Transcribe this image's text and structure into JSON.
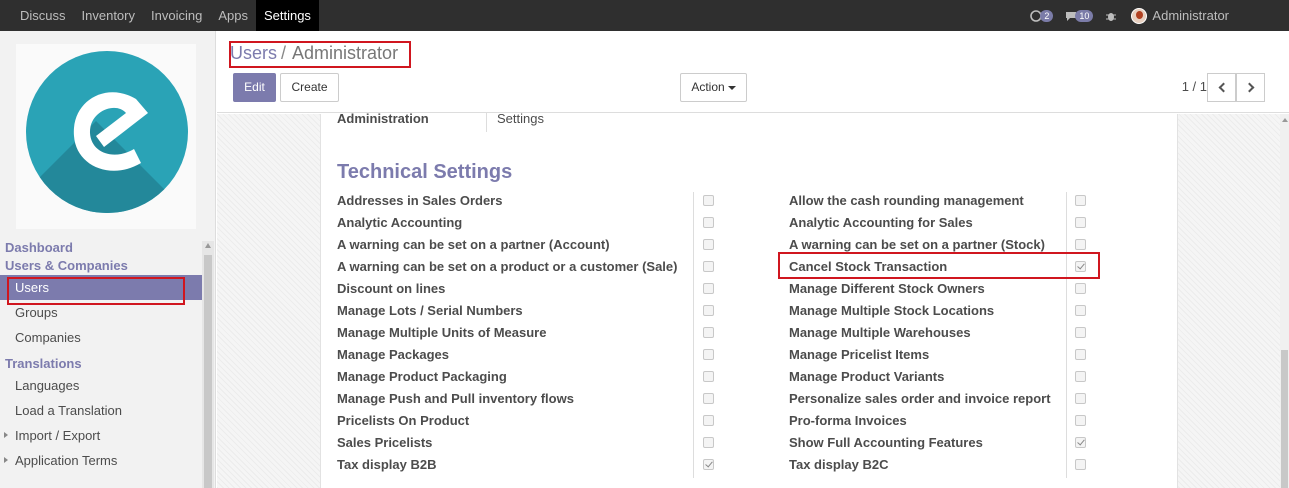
{
  "topbar": {
    "menu": [
      "Discuss",
      "Inventory",
      "Invoicing",
      "Apps",
      "Settings"
    ],
    "active_index": 4,
    "chat_count": "2",
    "messages_count": "10",
    "user": "Administrator"
  },
  "sidebar": {
    "sections": [
      {
        "header": "Dashboard",
        "items": []
      },
      {
        "header": "Users & Companies",
        "items": [
          "Users",
          "Groups",
          "Companies"
        ]
      },
      {
        "header": "Translations",
        "items": [
          "Languages",
          "Load a Translation",
          "Import / Export",
          "Application Terms"
        ]
      }
    ],
    "active_item": "Users"
  },
  "control_panel": {
    "breadcrumb_parent": "Users",
    "breadcrumb_sep": "/",
    "breadcrumb_current": "Administrator",
    "edit_label": "Edit",
    "create_label": "Create",
    "action_label": "Action",
    "pager": "1 / 1"
  },
  "form": {
    "admin_label": "Administration",
    "admin_value": "Settings",
    "section_title": "Technical Settings",
    "left": [
      {
        "label": "Addresses in Sales Orders",
        "checked": false
      },
      {
        "label": "Analytic Accounting",
        "checked": false
      },
      {
        "label": "A warning can be set on a partner (Account)",
        "checked": false
      },
      {
        "label": "A warning can be set on a product or a customer (Sale)",
        "checked": false
      },
      {
        "label": "Discount on lines",
        "checked": false
      },
      {
        "label": "Manage Lots / Serial Numbers",
        "checked": false
      },
      {
        "label": "Manage Multiple Units of Measure",
        "checked": false
      },
      {
        "label": "Manage Packages",
        "checked": false
      },
      {
        "label": "Manage Product Packaging",
        "checked": false
      },
      {
        "label": "Manage Push and Pull inventory flows",
        "checked": false
      },
      {
        "label": "Pricelists On Product",
        "checked": false
      },
      {
        "label": "Sales Pricelists",
        "checked": false
      },
      {
        "label": "Tax display B2B",
        "checked": true
      }
    ],
    "right": [
      {
        "label": "Allow the cash rounding management",
        "checked": false
      },
      {
        "label": "Analytic Accounting for Sales",
        "checked": false
      },
      {
        "label": "A warning can be set on a partner (Stock)",
        "checked": false
      },
      {
        "label": "Cancel Stock Transaction",
        "checked": true
      },
      {
        "label": "Manage Different Stock Owners",
        "checked": false
      },
      {
        "label": "Manage Multiple Stock Locations",
        "checked": false
      },
      {
        "label": "Manage Multiple Warehouses",
        "checked": false
      },
      {
        "label": "Manage Pricelist Items",
        "checked": false
      },
      {
        "label": "Manage Product Variants",
        "checked": false
      },
      {
        "label": "Personalize sales order and invoice report",
        "checked": false
      },
      {
        "label": "Pro-forma Invoices",
        "checked": false
      },
      {
        "label": "Show Full Accounting Features",
        "checked": true
      },
      {
        "label": "Tax display B2C",
        "checked": false
      }
    ]
  },
  "colors": {
    "accent": "#7c7bad",
    "highlight": "#d0161f",
    "logo": "#2aa3b6"
  }
}
